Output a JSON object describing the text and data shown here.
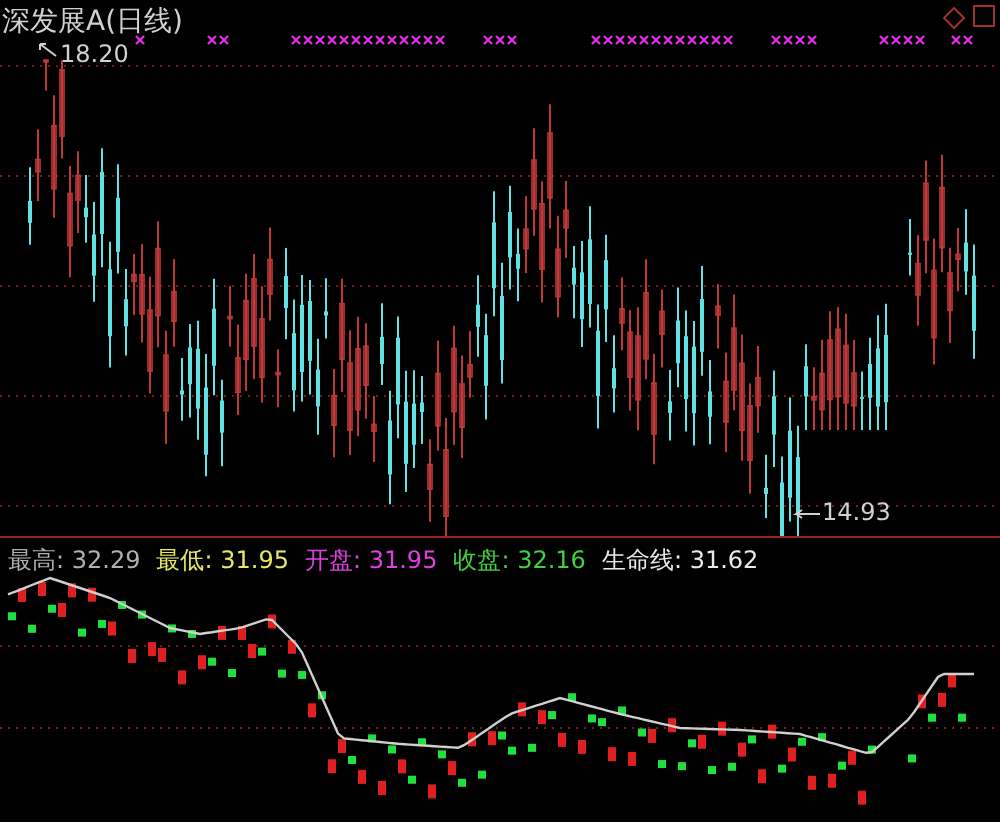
{
  "price_panel": {
    "title": "深发展A(日线)",
    "high_label": "18.20",
    "low_label": "14.93"
  },
  "indicator_panel": {
    "legend": [
      {
        "label": "最高:",
        "value": "32.29",
        "color": "#b0b0b0"
      },
      {
        "label": "最低:",
        "value": "31.95",
        "color": "#e8e860"
      },
      {
        "label": "开盘:",
        "value": "31.95",
        "color": "#e040e0"
      },
      {
        "label": "收盘:",
        "value": "32.16",
        "color": "#40d040"
      },
      {
        "label": "生命线:",
        "value": "31.62",
        "color": "#e8e8e8"
      }
    ]
  }
}
